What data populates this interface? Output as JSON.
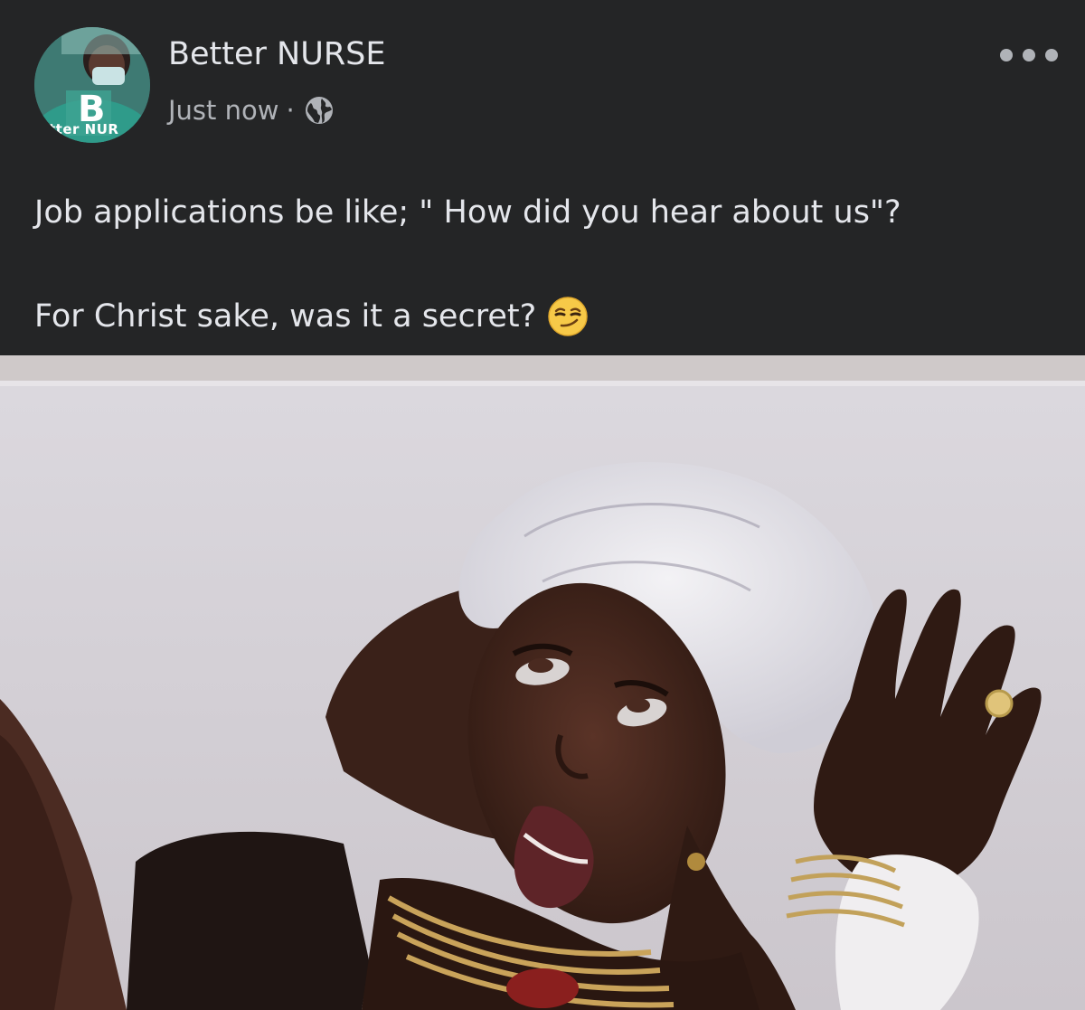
{
  "post": {
    "page_name": "Better NURSE",
    "avatar_text": "tter NUR",
    "timestamp": "Just now",
    "separator": "·",
    "privacy_icon": "globe-icon",
    "more_icon": "more-options-icon",
    "caption_line1": "Job applications be like; \" How did you hear about us\"?",
    "caption_line2": "For Christ sake, was it a secret?",
    "caption_emoji": "smirking-face-emoji",
    "image_alt": "Woman in white head wrap rolling her eyes upward with hand raised"
  },
  "colors": {
    "background": "#242526",
    "primary_text": "#e4e6eb",
    "secondary_text": "#b0b3b8",
    "avatar_teal": "#3f7f77"
  }
}
